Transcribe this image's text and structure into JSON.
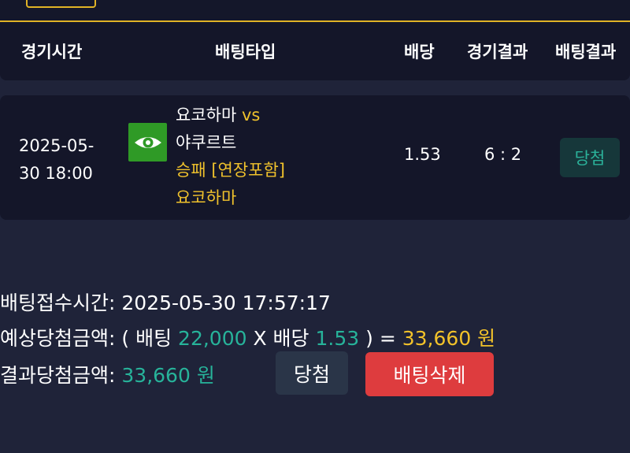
{
  "header": {
    "col_time": "경기시간",
    "col_bet_type": "배팅타입",
    "col_odds": "배당",
    "col_match_result": "경기결과",
    "col_bet_result": "배팅결과"
  },
  "bet_row": {
    "time_line1": "2025-05-",
    "time_line2": "30 18:00",
    "team_icon": "eye-icon",
    "home_team": "요코하마",
    "vs": "vs",
    "away_team": "야쿠르트",
    "market": "승패 [연장포함]",
    "pick": "요코하마",
    "odds": "1.53",
    "score": "6 : 2",
    "result": "당첨"
  },
  "summary": {
    "received_label": "배팅접수시간",
    "received_value": "2025-05-30 17:57:17",
    "expected_label": "예상당첨금액",
    "expected_open": "( 배팅",
    "stake": "22,000",
    "times_odds": "X 배당",
    "odds": "1.53",
    "expected_eq": ") =",
    "expected_amount": "33,660 원",
    "result_label": "결과당첨금액",
    "result_amount": "33,660 원"
  },
  "actions": {
    "win_label": "당첨",
    "delete_label": "배팅삭제"
  },
  "colors": {
    "background": "#1f2339",
    "panel": "#141629",
    "accent_gold": "#f0c22c",
    "accent_green": "#27b39a",
    "danger": "#de3c3e"
  }
}
